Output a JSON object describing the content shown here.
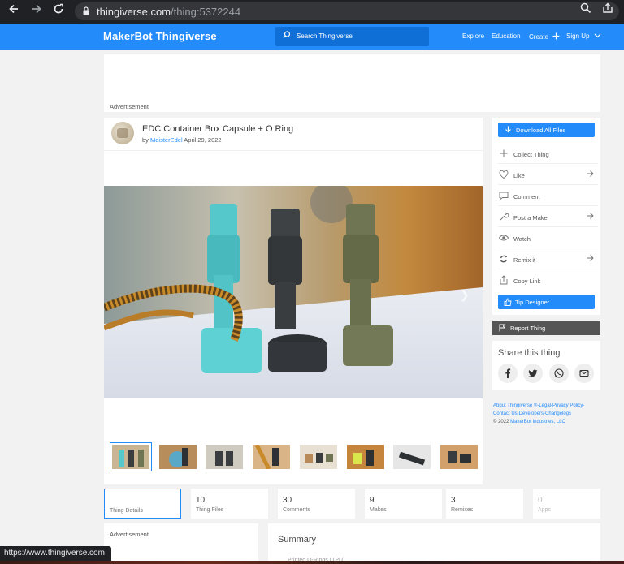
{
  "browser": {
    "url_domain": "thingiverse.com",
    "url_path": "/thing:5372244",
    "status_url": "https://www.thingiverse.com"
  },
  "header": {
    "logo": "MakerBot Thingiverse",
    "search_placeholder": "Search Thingiverse",
    "nav": [
      "Explore",
      "Education",
      "Create",
      "Sign Up"
    ]
  },
  "ads": {
    "label": "Advertisement"
  },
  "thing": {
    "title": "EDC Container Box Capsule + O Ring",
    "by": "by",
    "author": "MeisterEdel",
    "date": "April 29, 2022"
  },
  "actions": {
    "download": "Download All Files",
    "items": [
      "Collect Thing",
      "Like",
      "Comment",
      "Post a Make",
      "Watch",
      "Remix it",
      "Copy Link"
    ],
    "tip": "Tip Designer",
    "report": "Report Thing"
  },
  "share": {
    "title": "Share this thing",
    "icons": [
      "facebook-icon",
      "twitter-icon",
      "whatsapp-icon",
      "email-icon"
    ]
  },
  "footer": {
    "line1": "About Thingiverse ®-Legal-Privacy Policy-",
    "line2": "Contact Us-Developers-Changelogs",
    "copyright_prefix": "© 2022",
    "company": "MakerBot Industries, LLC"
  },
  "stats": [
    {
      "num": "",
      "label": "Thing Details"
    },
    {
      "num": "10",
      "label": "Thing Files"
    },
    {
      "num": "30",
      "label": "Comments"
    },
    {
      "num": "9",
      "label": "Makes"
    },
    {
      "num": "3",
      "label": "Remixes"
    },
    {
      "num": "0",
      "label": "Apps"
    }
  ],
  "summary": {
    "title": "Summary",
    "sub": "Printed O-Rings (TPU)"
  },
  "colors": {
    "brand_blue": "#248bfb",
    "capsule_teal": "#55c8cc",
    "capsule_black": "#3a3d40",
    "capsule_olive": "#6f7552"
  }
}
